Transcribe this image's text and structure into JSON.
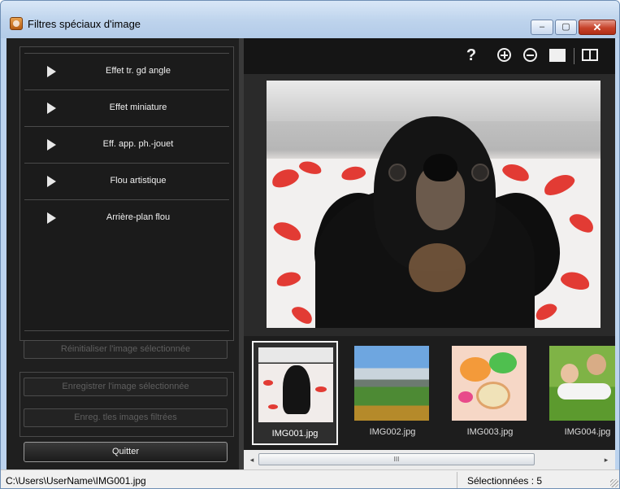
{
  "window": {
    "title": "Filtres spéciaux d'image",
    "controls": {
      "minimize": "–",
      "maximize": "▢",
      "close": "✕"
    }
  },
  "left_panel": {
    "effects": [
      {
        "label": "Effet tr. gd angle"
      },
      {
        "label": "Effet miniature"
      },
      {
        "label": "Eff. app. ph.-jouet"
      },
      {
        "label": "Flou artistique"
      },
      {
        "label": "Arrière-plan flou"
      }
    ],
    "reset_button": "Réinitialiser l'image sélectionnée",
    "save_selected_button": "Enregistrer l'image sélectionnée",
    "save_filtered_button": "Enreg. tles images filtrées",
    "quit_button": "Quitter"
  },
  "toolbar": {
    "help": "?",
    "icons": [
      "help-icon",
      "zoom-in-icon",
      "zoom-out-icon",
      "single-view-icon",
      "compare-view-icon"
    ]
  },
  "thumbnails": [
    {
      "name": "IMG001.jpg",
      "selected": true
    },
    {
      "name": "IMG002.jpg",
      "selected": false
    },
    {
      "name": "IMG003.jpg",
      "selected": false
    },
    {
      "name": "IMG004.jpg",
      "selected": false
    }
  ],
  "scrollbar": {
    "left_arrow": "◂",
    "right_arrow": "▸",
    "grip": "III"
  },
  "status_bar": {
    "path": "C:\\Users\\UserName\\IMG001.jpg",
    "selected_count": "Sélectionnées : 5"
  },
  "colors": {
    "panel_bg": "#1f1f1f",
    "accent_red": "#e23b34",
    "title_bar": "#bdd3ec"
  }
}
